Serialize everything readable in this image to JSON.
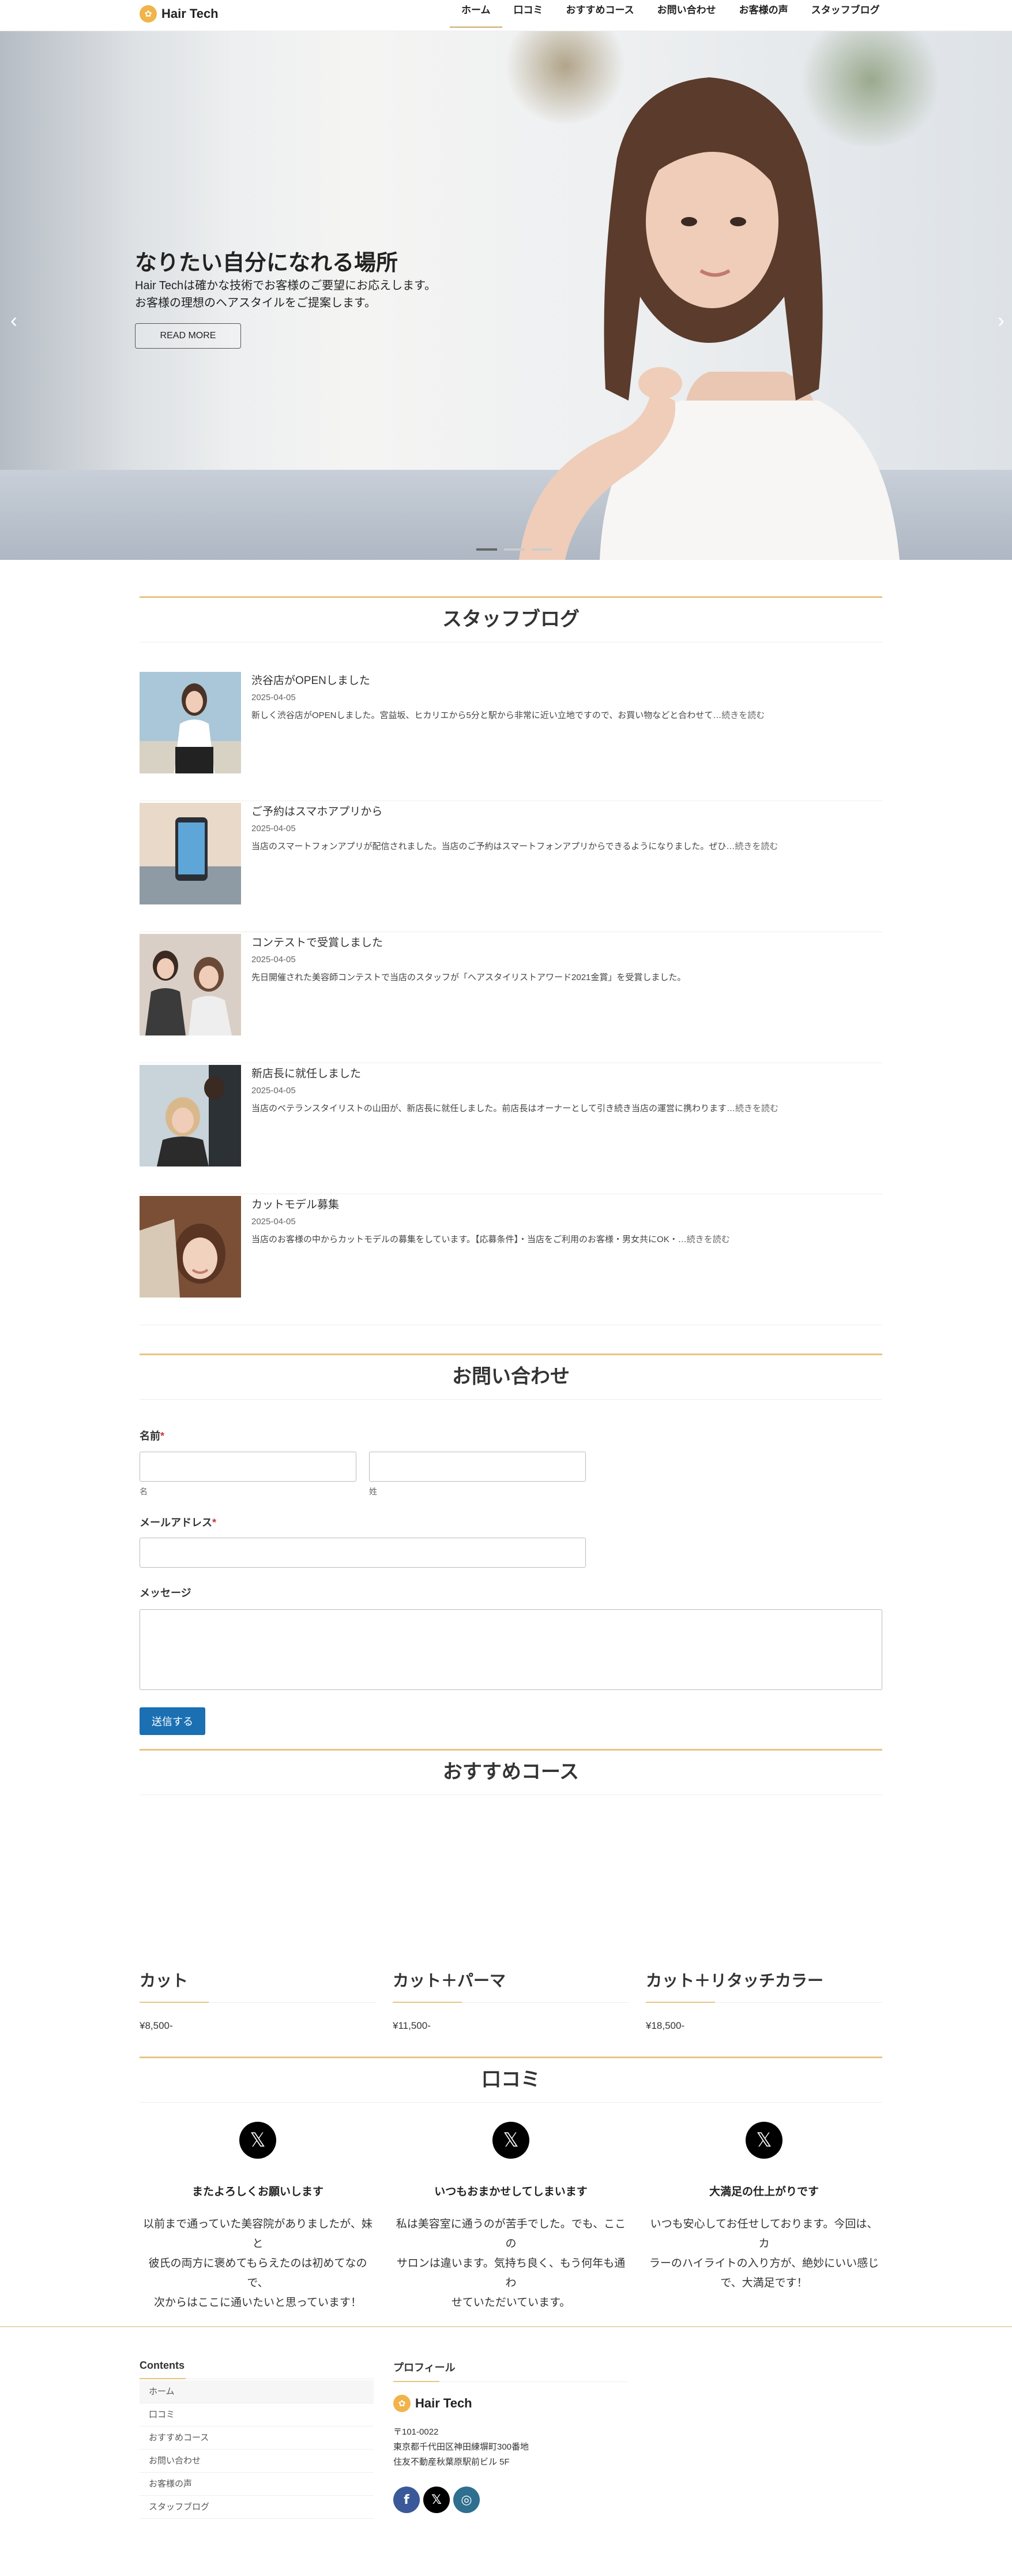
{
  "header": {
    "brand": "Hair Tech",
    "nav": [
      "ホーム",
      "口コミ",
      "おすすめコース",
      "お問い合わせ",
      "お客様の声",
      "スタッフブログ"
    ]
  },
  "hero": {
    "heading": "なりたい自分になれる場所",
    "line1": "Hair Techは確かな技術でお客様のご要望にお応えします。",
    "line2": "お客様の理想のヘアスタイルをご提案します。",
    "button": "READ MORE",
    "prev": "‹",
    "next": "›"
  },
  "blog": {
    "title": "スタッフブログ",
    "posts": [
      {
        "title": "渋谷店がOPENしました",
        "date": "2025-04-05",
        "excerpt": "新しく渋谷店がOPENしました。宮益坂、ヒカリエから5分と駅から非常に近い立地ですので、お買い物などと合わせて…",
        "more": "続きを読む"
      },
      {
        "title": "ご予約はスマホアプリから",
        "date": "2025-04-05",
        "excerpt": "当店のスマートフォンアプリが配信されました。当店のご予約はスマートフォンアプリからできるようになりました。ぜひ…",
        "more": "続きを読む"
      },
      {
        "title": "コンテストで受賞しました",
        "date": "2025-04-05",
        "excerpt": "先日開催された美容師コンテストで当店のスタッフが「ヘアスタイリストアワード2021金賞」を受賞しました。",
        "more": ""
      },
      {
        "title": "新店長に就任しました",
        "date": "2025-04-05",
        "excerpt": "当店のベテランスタイリストの山田が、新店長に就任しました。前店長はオーナーとして引き続き当店の運営に携わります…",
        "more": "続きを読む"
      },
      {
        "title": "カットモデル募集",
        "date": "2025-04-05",
        "excerpt": "当店のお客様の中からカットモデルの募集をしています。【応募条件】・当店をご利用のお客様・男女共にOK・…",
        "more": "続きを読む"
      }
    ]
  },
  "contact": {
    "title": "お問い合わせ",
    "name_label": "名前",
    "required_mark": "*",
    "first_sub": "名",
    "last_sub": "姓",
    "email_label": "メールアドレス",
    "message_label": "メッセージ",
    "submit": "送信する"
  },
  "courses": {
    "title": "おすすめコース",
    "items": [
      {
        "name": "カット",
        "price": "¥8,500-"
      },
      {
        "name": "カット＋パーマ",
        "price": "¥11,500-"
      },
      {
        "name": "カット＋リタッチカラー",
        "price": "¥18,500-"
      }
    ]
  },
  "reviews": {
    "title": "口コミ",
    "icon": "x-logo-icon",
    "items": [
      {
        "title": "またよろしくお願いします",
        "lines": [
          "以前まで通っていた美容院がありましたが、妹と",
          "彼氏の両方に褒めてもらえたのは初めてなので、",
          "次からはここに通いたいと思っています！"
        ]
      },
      {
        "title": "いつもおまかせしてしまいます",
        "lines": [
          "私は美容室に通うのが苦手でした。でも、ここの",
          "サロンは違います。気持ち良く、もう何年も通わ",
          "せていただいています。"
        ]
      },
      {
        "title": "大満足の仕上がりです",
        "lines": [
          "いつも安心してお任せしております。今回は、カ",
          "ラーのハイライトの入り方が、絶妙にいい感じ",
          "で、大満足です！"
        ]
      }
    ]
  },
  "footer": {
    "contents_title": "Contents",
    "links": [
      "ホーム",
      "口コミ",
      "おすすめコース",
      "お問い合わせ",
      "お客様の声",
      "スタッフブログ"
    ],
    "profile_title": "プロフィール",
    "brand": "Hair Tech",
    "postal": "〒101-0022",
    "addr1": "東京都千代田区神田練塀町300番地",
    "addr2": "住友不動産秋葉原駅前ビル 5F",
    "social": [
      "facebook-icon",
      "x-icon",
      "instagram-icon"
    ],
    "colors": {
      "facebook": "#3b5998",
      "x": "#000000",
      "instagram": "#2f6f8f"
    }
  }
}
